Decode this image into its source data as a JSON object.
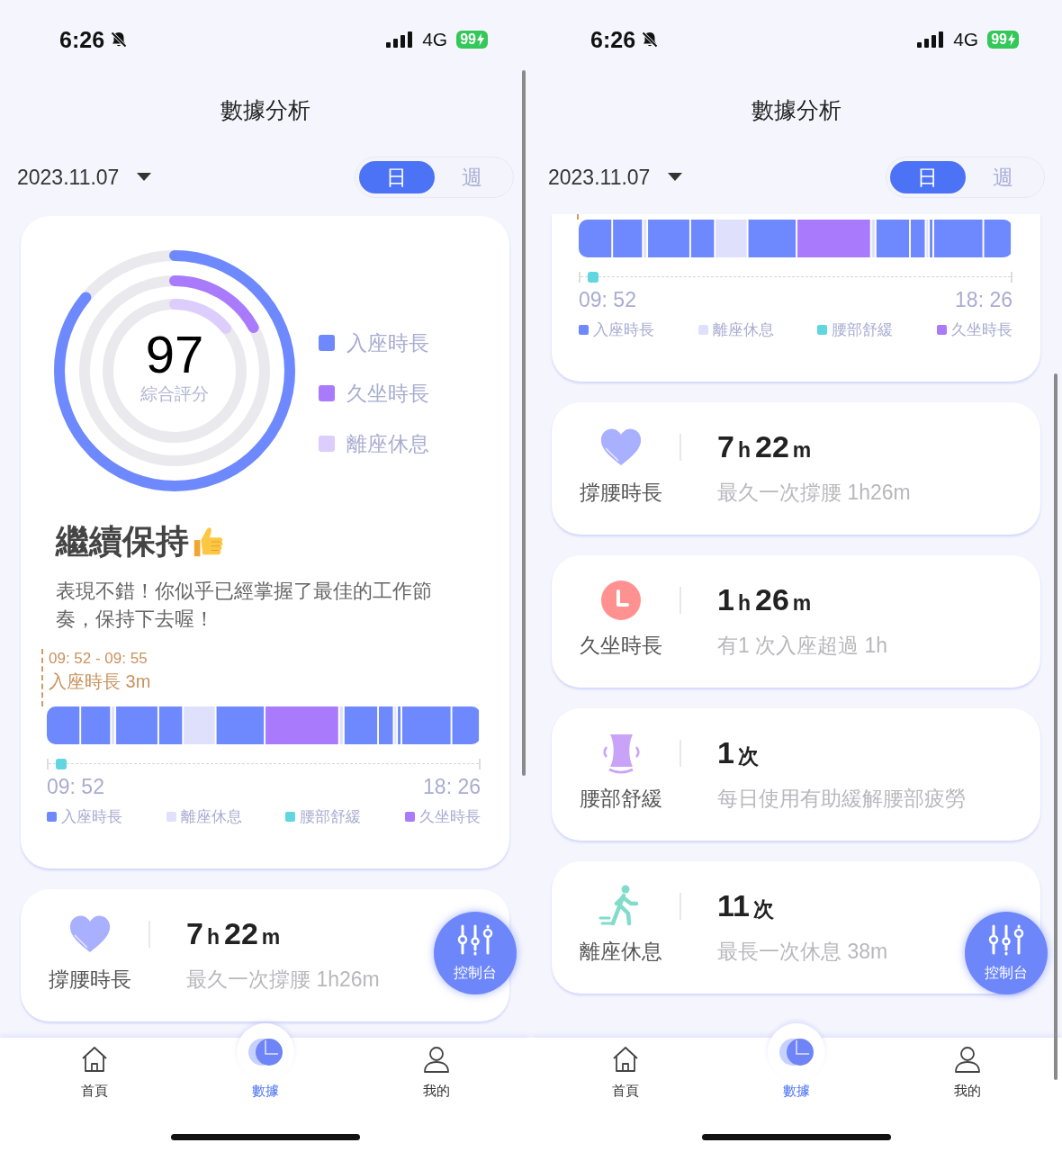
{
  "screens": [
    {
      "status": {
        "time": "6:26",
        "network": "4G",
        "battery": "99"
      },
      "title": "數據分析",
      "date": "2023.11.07",
      "range_tabs": [
        {
          "label": "日",
          "selected": true
        },
        {
          "label": "週",
          "selected": false
        }
      ],
      "summary": {
        "score": "97",
        "score_label": "綜合評分",
        "rings": [
          {
            "label": "入座時長",
            "color": "#6e88fd",
            "level": 0.86
          },
          {
            "label": "久坐時長",
            "color": "#a97afc",
            "level": 0.17
          },
          {
            "label": "離座休息",
            "color": "#dccdfc",
            "level": 0.14
          }
        ],
        "headline": "繼續保持",
        "message": "表現不錯！你似乎已經掌握了最佳的工作節奏，保持下去喔！"
      },
      "timeline": {
        "tooltip_time": "09: 52 - 09: 55",
        "tooltip_text": "入座時長 3m",
        "start": "09: 52",
        "end": "18: 26",
        "legend": [
          {
            "label": "入座時長",
            "color": "#6e88fd"
          },
          {
            "label": "離座休息",
            "color": "#dfe0fb"
          },
          {
            "label": "腰部舒緩",
            "color": "#5fd6e0"
          },
          {
            "label": "久坐時長",
            "color": "#a97afc"
          }
        ]
      },
      "stats": [
        {
          "kind": "heart",
          "label": "撐腰時長",
          "value": [
            {
              "text": "7",
              "kind": "number"
            },
            {
              "text": "h",
              "kind": "unit"
            },
            {
              "text": "22",
              "kind": "number"
            },
            {
              "text": "m",
              "kind": "unit"
            }
          ],
          "note": "最久一次撐腰 1h26m"
        }
      ],
      "fab_label": "控制台",
      "nav": [
        {
          "label": "首頁",
          "kind": "home",
          "selected": false
        },
        {
          "label": "數據",
          "kind": "chart",
          "selected": true
        },
        {
          "label": "我的",
          "kind": "person",
          "selected": false
        }
      ]
    },
    {
      "status": {
        "time": "6:26",
        "network": "4G",
        "battery": "99"
      },
      "title": "數據分析",
      "date": "2023.11.07",
      "range_tabs": [
        {
          "label": "日",
          "selected": true
        },
        {
          "label": "週",
          "selected": false
        }
      ],
      "timeline": {
        "start": "09: 52",
        "end": "18: 26",
        "legend": [
          {
            "label": "入座時長",
            "color": "#6e88fd"
          },
          {
            "label": "離座休息",
            "color": "#dfe0fb"
          },
          {
            "label": "腰部舒緩",
            "color": "#5fd6e0"
          },
          {
            "label": "久坐時長",
            "color": "#a97afc"
          }
        ]
      },
      "stats": [
        {
          "kind": "heart",
          "label": "撐腰時長",
          "value": [
            {
              "text": "7",
              "kind": "number"
            },
            {
              "text": "h",
              "kind": "unit"
            },
            {
              "text": "22",
              "kind": "number"
            },
            {
              "text": "m",
              "kind": "unit"
            }
          ],
          "note": "最久一次撐腰 1h26m"
        },
        {
          "kind": "clock",
          "label": "久坐時長",
          "value": [
            {
              "text": "1",
              "kind": "number"
            },
            {
              "text": "h",
              "kind": "unit"
            },
            {
              "text": "26",
              "kind": "number"
            },
            {
              "text": "m",
              "kind": "unit"
            }
          ],
          "note": "有1 次入座超過 1h"
        },
        {
          "kind": "waist",
          "label": "腰部舒緩",
          "value": [
            {
              "text": "1",
              "kind": "number"
            },
            {
              "text": "次",
              "kind": "unit"
            }
          ],
          "note": "每日使用有助緩解腰部疲勞"
        },
        {
          "kind": "walker",
          "label": "離座休息",
          "value": [
            {
              "text": "11",
              "kind": "number"
            },
            {
              "text": "次",
              "kind": "unit"
            }
          ],
          "note": "最長一次休息 38m"
        }
      ],
      "fab_label": "控制台",
      "nav": [
        {
          "label": "首頁",
          "kind": "home",
          "selected": false
        },
        {
          "label": "數據",
          "kind": "chart",
          "selected": true
        },
        {
          "label": "我的",
          "kind": "person",
          "selected": false
        }
      ]
    }
  ]
}
